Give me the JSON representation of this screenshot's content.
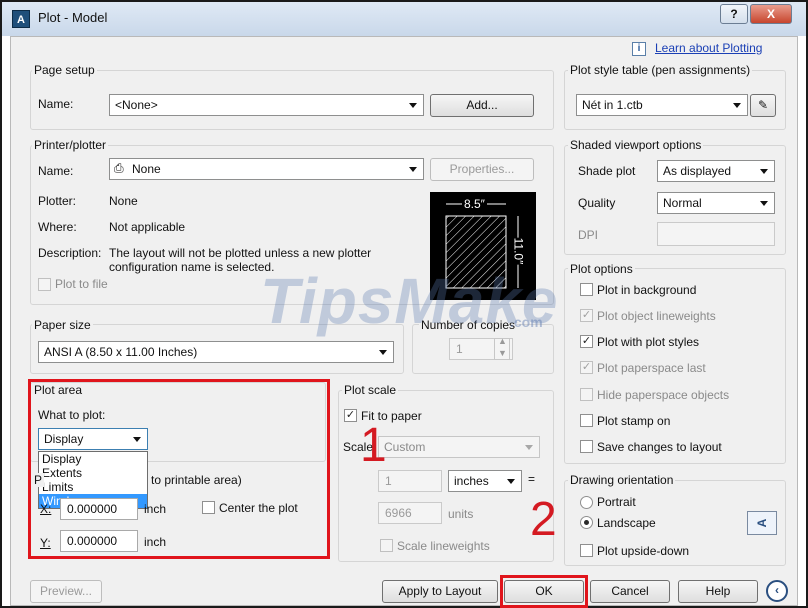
{
  "window": {
    "title": "Plot - Model",
    "app_icon_text": "A",
    "help_glyph": "?",
    "close_glyph": "X"
  },
  "help": {
    "info_glyph": "i",
    "link": "Learn about Plotting"
  },
  "page_setup": {
    "title": "Page setup",
    "name_label": "Name:",
    "name_value": "<None>",
    "add_button": "Add..."
  },
  "printer": {
    "title": "Printer/plotter",
    "name_label": "Name:",
    "name_value": "None",
    "properties_button": "Properties...",
    "plotter_label": "Plotter:",
    "plotter_value": "None",
    "where_label": "Where:",
    "where_value": "Not applicable",
    "description_label": "Description:",
    "description_line1": "The layout will not be plotted unless a new plotter",
    "description_line2": "configuration name is selected.",
    "plot_to_file": "Plot to file",
    "preview_width": "8.5″",
    "preview_height": "11.0″"
  },
  "paper_size": {
    "title": "Paper size",
    "value": "ANSI A (8.50 x 11.00 Inches)"
  },
  "copies": {
    "title": "Number of copies",
    "value": "1"
  },
  "plot_area": {
    "title": "Plot area",
    "what_label": "What to plot:",
    "selected": "Display",
    "options": [
      "Display",
      "Extents",
      "Limits",
      "Window"
    ],
    "highlighted": "Window"
  },
  "plot_offset": {
    "title_partial": "to printable area)",
    "title_prefix": "P",
    "x_label": "X:",
    "x_value": "0.000000",
    "x_unit": "inch",
    "y_label": "Y:",
    "y_value": "0.000000",
    "y_unit": "inch",
    "center": "Center the plot"
  },
  "plot_scale": {
    "title": "Plot scale",
    "fit": "Fit to paper",
    "scale_label": "Scale:",
    "scale_value": "Custom",
    "num_value": "1",
    "units_value": "inches",
    "equals": "=",
    "den_value": "6966",
    "den_unit": "units",
    "lineweights": "Scale lineweights"
  },
  "plot_style": {
    "title": "Plot style table (pen assignments)",
    "value": "Nét in  1.ctb"
  },
  "shaded": {
    "title": "Shaded viewport options",
    "shade_label": "Shade plot",
    "shade_value": "As displayed",
    "quality_label": "Quality",
    "quality_value": "Normal",
    "dpi_label": "DPI"
  },
  "plot_options": {
    "title": "Plot options",
    "items": [
      {
        "label": "Plot in background",
        "checked": false,
        "enabled": true
      },
      {
        "label": "Plot object lineweights",
        "checked": true,
        "enabled": false
      },
      {
        "label": "Plot with plot styles",
        "checked": true,
        "enabled": true
      },
      {
        "label": "Plot paperspace last",
        "checked": true,
        "enabled": false
      },
      {
        "label": "Hide paperspace objects",
        "checked": false,
        "enabled": false
      },
      {
        "label": "Plot stamp on",
        "checked": false,
        "enabled": true
      },
      {
        "label": "Save changes to layout",
        "checked": false,
        "enabled": true
      }
    ]
  },
  "orientation": {
    "title": "Drawing orientation",
    "portrait": "Portrait",
    "landscape": "Landscape",
    "upside": "Plot upside-down",
    "selected": "Landscape",
    "icon_letter": "A"
  },
  "footer": {
    "preview": "Preview...",
    "apply": "Apply to Layout",
    "ok": "OK",
    "cancel": "Cancel",
    "help": "Help",
    "expand_glyph": "‹"
  },
  "annotations": {
    "marker1": "1",
    "marker2": "2",
    "highlight_color": "#e0151c"
  },
  "watermark": {
    "text": "TipsMake",
    "suffix": ".com"
  }
}
